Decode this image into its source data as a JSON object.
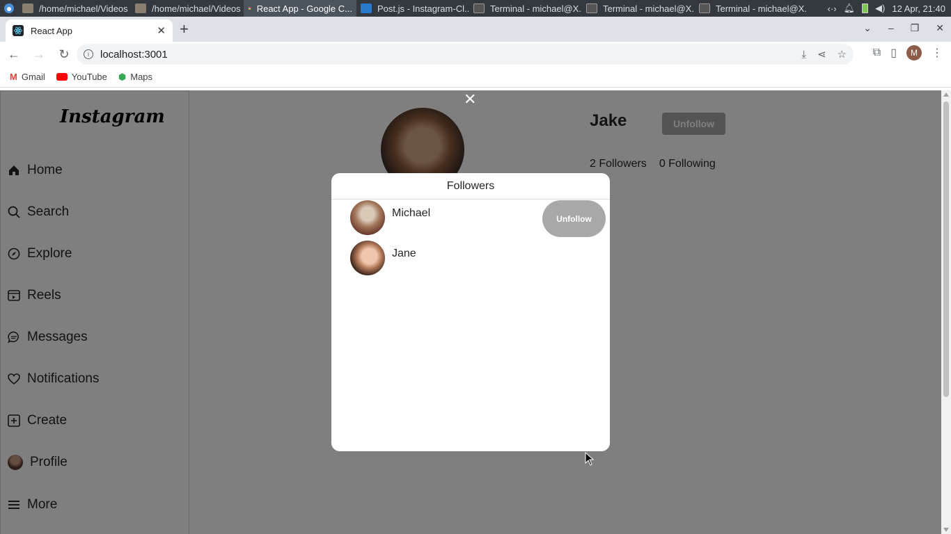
{
  "taskbar": {
    "tasks": [
      {
        "label": "/home/michael/Videos",
        "icon": "folder-icon"
      },
      {
        "label": "/home/michael/Videos",
        "icon": "folder-icon"
      },
      {
        "label": "React App - Google C...",
        "icon": "chrome-icon"
      },
      {
        "label": "Post.js - Instagram-Cl...",
        "icon": "vscode-icon"
      },
      {
        "label": "Terminal - michael@X...",
        "icon": "terminal-icon"
      },
      {
        "label": "Terminal - michael@X...",
        "icon": "terminal-icon"
      },
      {
        "label": "Terminal - michael@X...",
        "icon": "terminal-icon"
      }
    ],
    "clock": "12 Apr, 21:40"
  },
  "browser": {
    "tab_title": "React App",
    "url": "localhost:3001",
    "bookmarks": [
      {
        "label": "Gmail",
        "color": "#ea4335"
      },
      {
        "label": "YouTube",
        "color": "#ff0000"
      },
      {
        "label": "Maps",
        "color": "#34a853"
      }
    ],
    "profile_initial": "M"
  },
  "app": {
    "logo": "Instagram",
    "nav": [
      {
        "label": "Home",
        "icon": "home-icon"
      },
      {
        "label": "Search",
        "icon": "search-icon"
      },
      {
        "label": "Explore",
        "icon": "compass-icon"
      },
      {
        "label": "Reels",
        "icon": "reels-icon"
      },
      {
        "label": "Messages",
        "icon": "message-icon"
      },
      {
        "label": "Notifications",
        "icon": "heart-icon"
      },
      {
        "label": "Create",
        "icon": "plus-square-icon"
      },
      {
        "label": "Profile",
        "icon": "avatar"
      },
      {
        "label": "More",
        "icon": "menu-icon"
      }
    ],
    "profile": {
      "username": "Jake",
      "unfollow_label": "Unfollow",
      "followers": "2 Followers",
      "following": "0 Following"
    },
    "modal": {
      "title": "Followers",
      "followers": [
        {
          "name": "Michael",
          "action": "Unfollow"
        },
        {
          "name": "Jane"
        }
      ]
    }
  }
}
